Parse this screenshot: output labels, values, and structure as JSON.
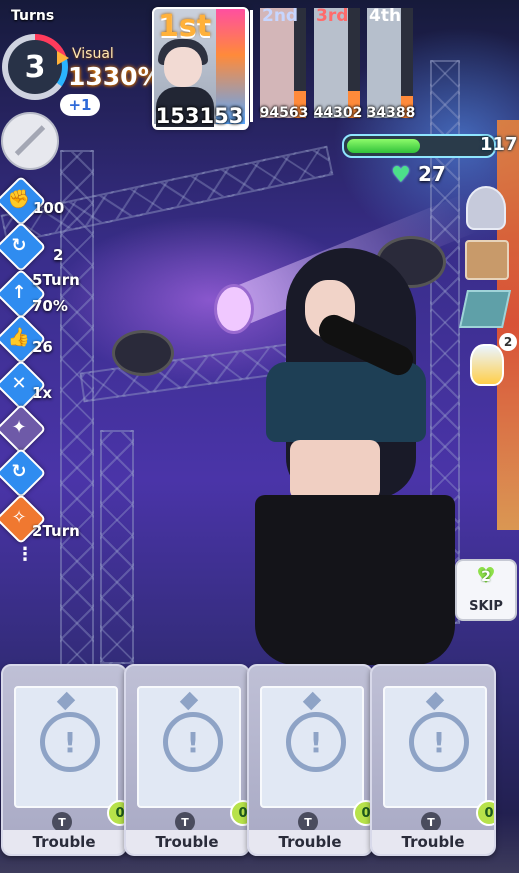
{
  "hud": {
    "turns_label": "Turns",
    "turns_left": "3",
    "visual_label": "Visual",
    "visual_value": "1330%",
    "plus_badge": "+1"
  },
  "buffs": [
    {
      "name": "fist",
      "icon": "fist-icon",
      "color": "#2f8cf0",
      "value": "100"
    },
    {
      "name": "refresh",
      "icon": "refresh-icon",
      "color": "#2f8cf0",
      "value": "2"
    },
    {
      "name": "up-arrow",
      "icon": "up-arrow-icon",
      "color": "#2f8cf0",
      "value": "5Turn",
      "value2": "70%"
    },
    {
      "name": "thumbs-up",
      "icon": "thumbs-up-icon",
      "color": "#2f8cf0",
      "value": "26"
    },
    {
      "name": "cancel",
      "icon": "cancel-arrow-icon",
      "color": "#2f8cf0",
      "value": "1x"
    },
    {
      "name": "purple-skill",
      "icon": "character-skill-icon",
      "color": "#6e5aa8",
      "value": ""
    },
    {
      "name": "refresh-2",
      "icon": "refresh-icon",
      "color": "#2f8cf0",
      "value": ""
    },
    {
      "name": "orange-skill",
      "icon": "sparkle-icon",
      "color": "#f07830",
      "value": "2Turn"
    }
  ],
  "ranking": {
    "first": {
      "place": "1st",
      "score": "153153"
    },
    "others": [
      {
        "place": "2nd",
        "score": "94563",
        "place_color": "#c7d6ff",
        "fill": 0.25
      },
      {
        "place": "3rd",
        "score": "44302",
        "place_color": "#ff6b6b",
        "fill": 0.25
      },
      {
        "place": "4th",
        "score": "34388",
        "place_color": "#ffffff",
        "fill": 0.2
      }
    ]
  },
  "stamina": {
    "value": "117",
    "fill": 0.52
  },
  "hearts": {
    "value": "27"
  },
  "side_badge": "2",
  "skip": {
    "label": "SKIP",
    "cost": "2"
  },
  "cards": [
    {
      "name": "Trouble",
      "type": "T",
      "cost": "0"
    },
    {
      "name": "Trouble",
      "type": "T",
      "cost": "0"
    },
    {
      "name": "Trouble",
      "type": "T",
      "cost": "0"
    },
    {
      "name": "Trouble",
      "type": "T",
      "cost": "0"
    }
  ]
}
